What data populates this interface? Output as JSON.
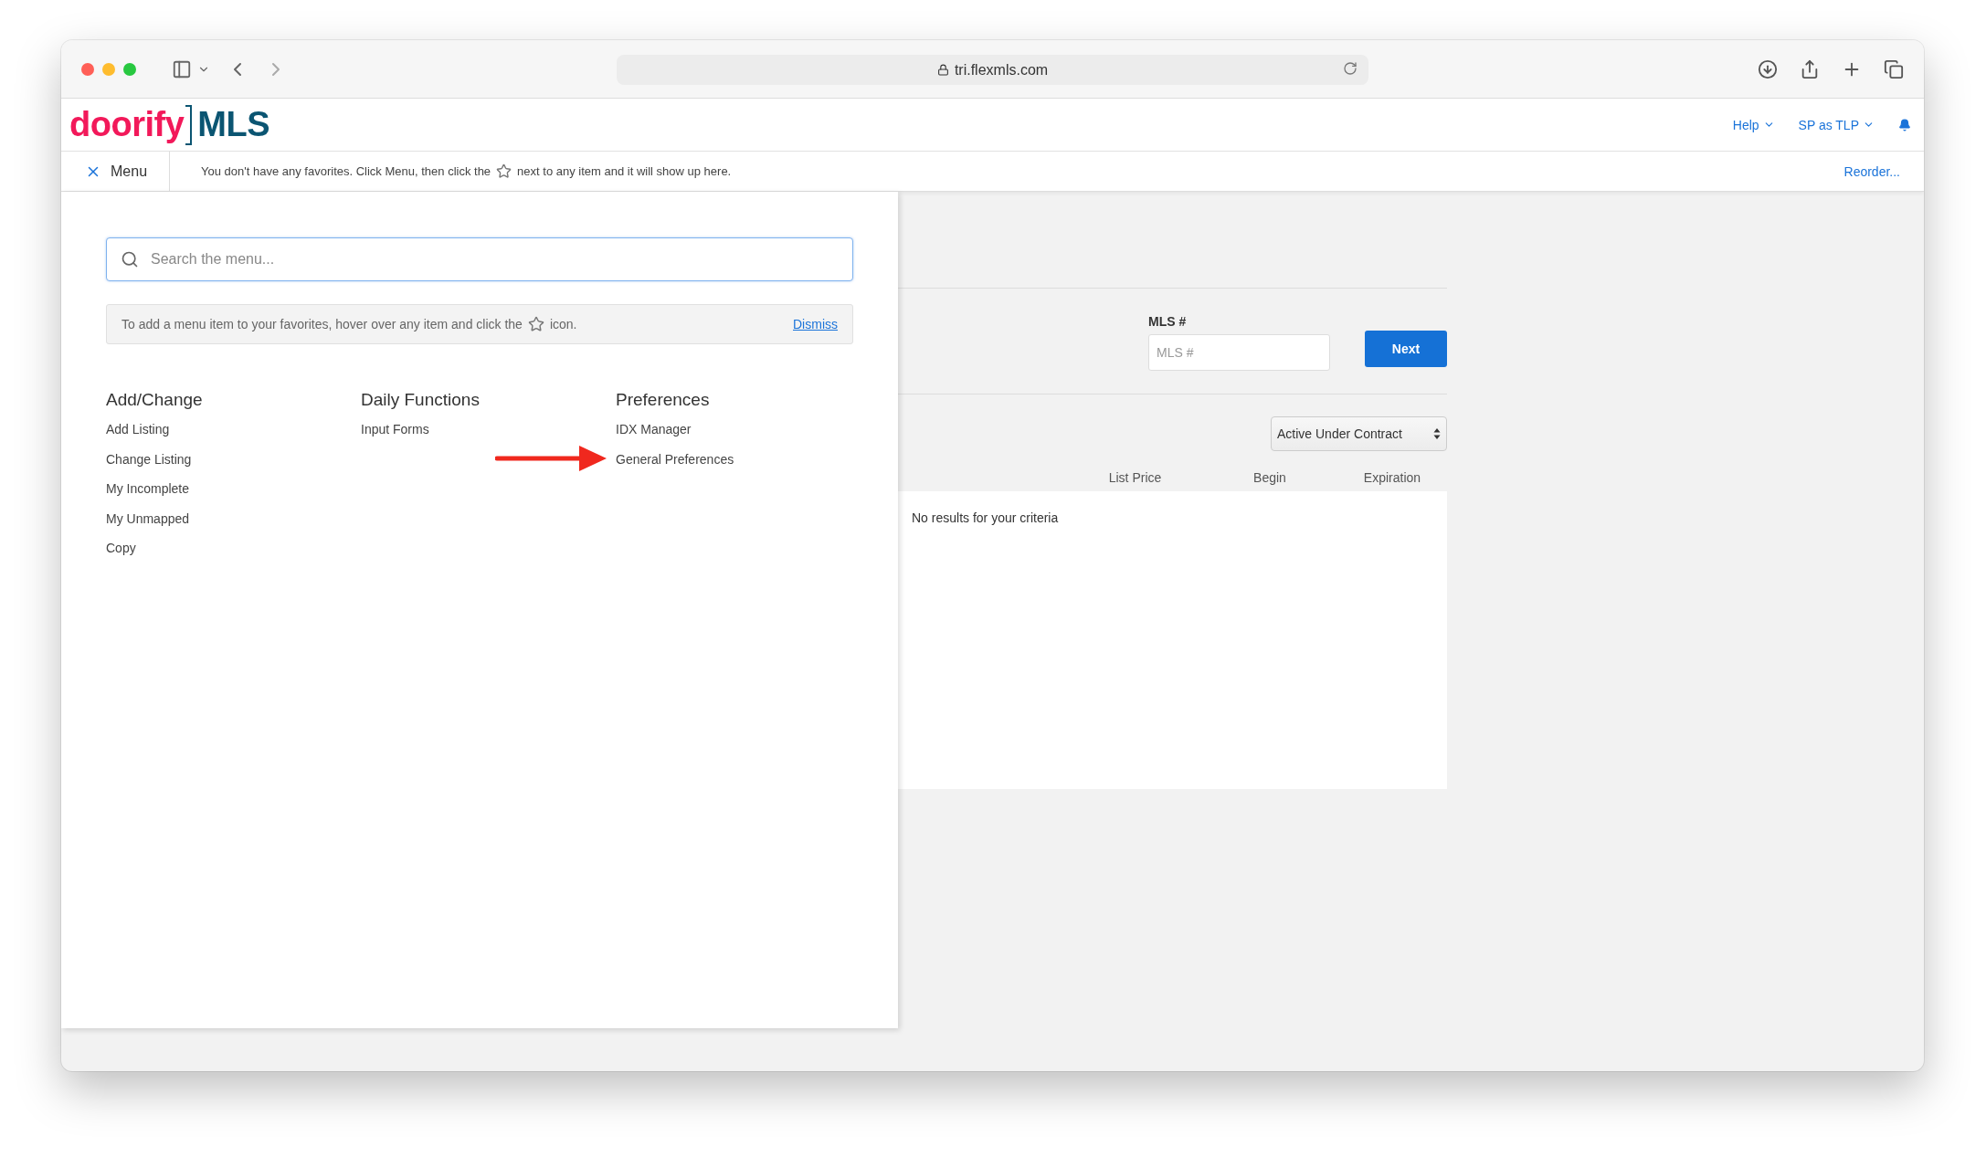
{
  "browser": {
    "url": "tri.flexmls.com"
  },
  "header": {
    "logo": {
      "brand": "doorify",
      "product": "MLS"
    },
    "links": [
      {
        "label": "Help"
      },
      {
        "label": "SP as TLP"
      }
    ]
  },
  "favorites_bar": {
    "menu_label": "Menu",
    "text_before_icon": "You don't have any favorites. Click Menu, then click the",
    "text_after_icon": "next to any item and it will show up here.",
    "reorder": "Reorder..."
  },
  "menu": {
    "search": {
      "placeholder": "Search the menu..."
    },
    "notice": {
      "text_before_icon": "To add a menu item to your favorites, hover over any item and click the",
      "text_after_icon": "icon.",
      "dismiss": "Dismiss"
    },
    "columns": [
      {
        "heading": "Add/Change",
        "items": [
          {
            "label": "Add Listing"
          },
          {
            "label": "Change Listing"
          },
          {
            "label": "My Incomplete"
          },
          {
            "label": "My Unmapped"
          },
          {
            "label": "Copy"
          }
        ]
      },
      {
        "heading": "Daily Functions",
        "items": [
          {
            "label": "Input Forms"
          }
        ]
      },
      {
        "heading": "Preferences",
        "items": [
          {
            "label": "IDX Manager"
          },
          {
            "label": "General Preferences"
          }
        ]
      }
    ]
  },
  "main": {
    "mls_field": {
      "label": "MLS #",
      "placeholder": "MLS #"
    },
    "next_button": "Next",
    "status_select": "Active Under Contract",
    "table": {
      "columns": [
        "List Price",
        "Begin",
        "Expiration"
      ],
      "empty_message": "No results for your criteria"
    }
  }
}
